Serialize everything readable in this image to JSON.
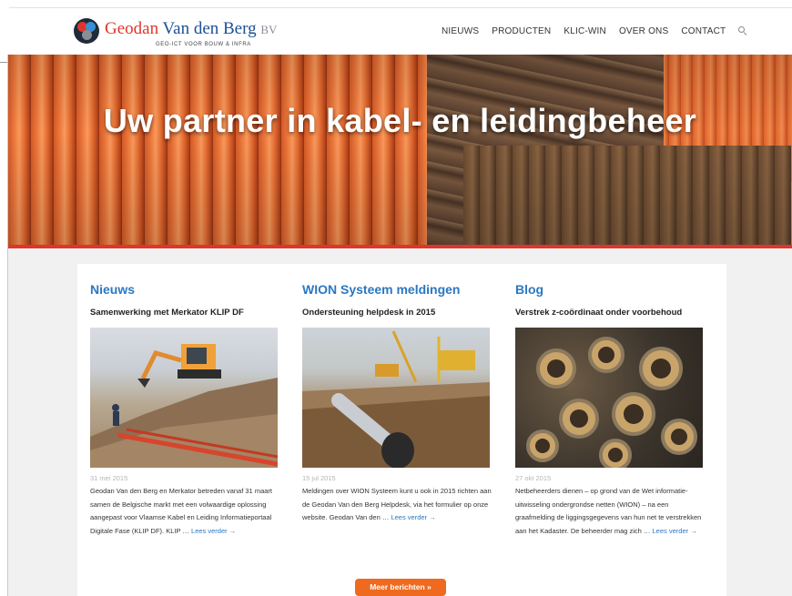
{
  "header": {
    "logo": {
      "name_part1": "Geodan",
      "name_part2": "Van den Berg",
      "name_part3": "BV",
      "tagline": "GEO-ICT VOOR BOUW & INFRA"
    },
    "nav": [
      {
        "label": "NIEUWS"
      },
      {
        "label": "PRODUCTEN"
      },
      {
        "label": "KLIC-WIN"
      },
      {
        "label": "OVER ONS"
      },
      {
        "label": "CONTACT"
      }
    ],
    "search_icon": "search-icon"
  },
  "hero": {
    "title": "Uw partner in kabel- en leidingbeheer"
  },
  "colors": {
    "accent_red": "#e0352b",
    "link_blue": "#2a78c2",
    "button_orange": "#ef6a1f"
  },
  "columns": [
    {
      "heading": "Nieuws",
      "subheading": "Samenwerking met Merkator KLIP DF",
      "date": "31 mei 2015",
      "text": "Geodan Van den Berg en Merkator betreden vanaf 31 maart samen de Belgische markt met een volwaardige oplossing aangepast voor Vlaamse Kabel en Leiding Informatieportaal Digitale Fase (KLIP DF). KLIP …",
      "more": "Lees verder →"
    },
    {
      "heading": "WION Systeem meldingen",
      "subheading": "Ondersteuning helpdesk in 2015",
      "date": "15 jul 2015",
      "text": "Meldingen over WION Systeem kunt u ook in 2015 richten aan de Geodan Van den Berg Helpdesk, via het formulier op onze website. Geodan Van den …",
      "more": "Lees verder →"
    },
    {
      "heading": "Blog",
      "subheading": "Verstrek z-coördinaat onder voorbehoud",
      "date": "27 okt 2015",
      "text": "Netbeheerders dienen – op grond van de Wet informatie-uitwisseling ondergrondse netten (WION) – na een graafmelding de liggingsgegevens van hun net te verstrekken aan het Kadaster. De beheerder mag zich …",
      "more": "Lees verder →"
    }
  ],
  "more_button": "Meer berichten »"
}
